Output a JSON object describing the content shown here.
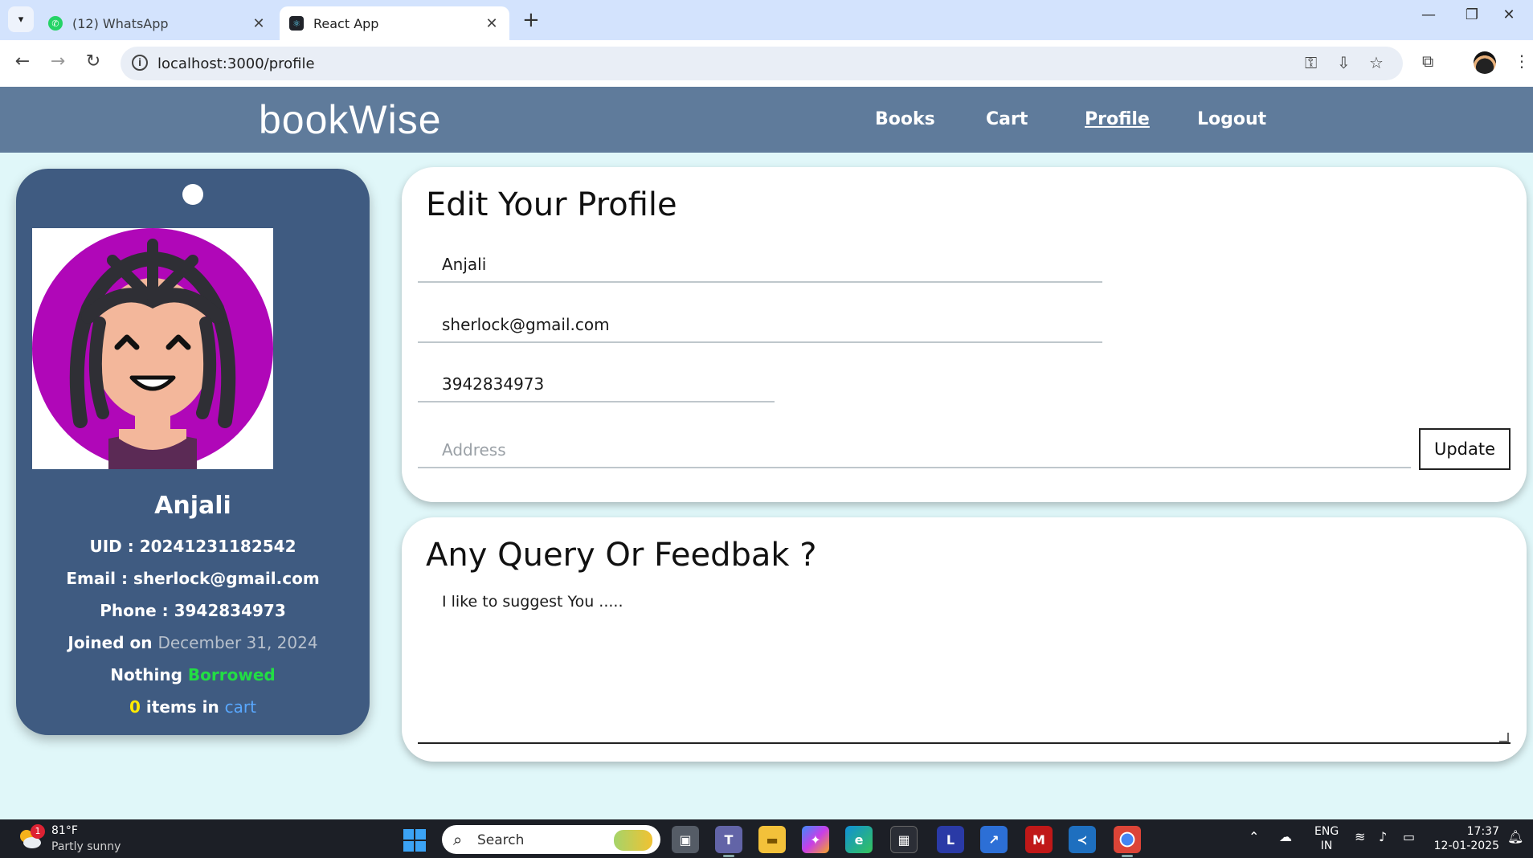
{
  "browser": {
    "tabs": [
      {
        "title": "(12) WhatsApp",
        "active": false
      },
      {
        "title": "React App",
        "active": true
      }
    ],
    "url": "localhost:3000/profile"
  },
  "app": {
    "brand": "bookWise",
    "nav": [
      {
        "label": "Books",
        "active": false
      },
      {
        "label": "Cart",
        "active": false
      },
      {
        "label": "Profile",
        "active": true
      },
      {
        "label": "Logout",
        "active": false
      }
    ]
  },
  "profile_card": {
    "name": "Anjali",
    "uid_label": "UID : ",
    "uid": "20241231182542",
    "email_label": "Email : ",
    "email": "sherlock@gmail.com",
    "phone_label": "Phone : ",
    "phone": "3942834973",
    "joined_label": "Joined on ",
    "joined_date": "December 31, 2024",
    "borrow_prefix": "Nothing ",
    "borrow_status": "Borrowed",
    "cart_count": "0",
    "cart_mid": " items in ",
    "cart_word": "cart"
  },
  "edit_profile": {
    "title": "Edit Your Profile",
    "name_value": "Anjali",
    "email_value": "sherlock@gmail.com",
    "phone_value": "3942834973",
    "address_placeholder": "Address",
    "update_label": "Update"
  },
  "feedback": {
    "title": "Any Query Or Feedbak ?",
    "value": "I like to suggest You ....."
  },
  "taskbar": {
    "weather_badge": "1",
    "temperature": "81°F",
    "weather": "Partly sunny",
    "search_label": "Search",
    "lang_line1": "ENG",
    "lang_line2": "IN",
    "time": "17:37",
    "date": "12-01-2025"
  },
  "colors": {
    "header": "#5f7b9b",
    "card": "#3f5b81",
    "page_bg": "#e0f7f9",
    "borrowed": "#22dd44",
    "cart_count": "#ffea00",
    "cart_link": "#59a8ff"
  }
}
